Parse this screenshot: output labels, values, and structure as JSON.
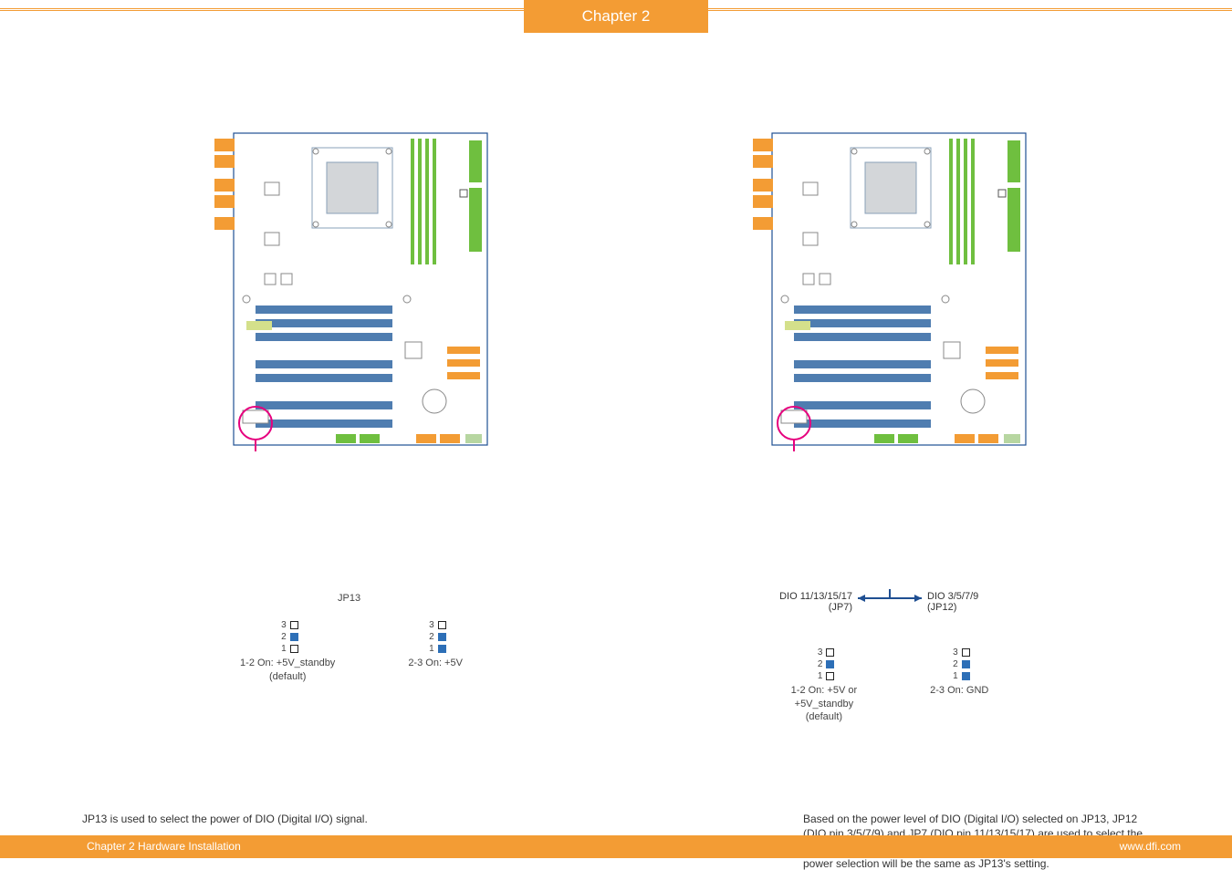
{
  "header": {
    "chapter": "Chapter 2"
  },
  "footer": {
    "left": "Chapter 2 Hardware Installation",
    "right": "www.dfi.com"
  },
  "left_panel": {
    "jp_label": "JP13",
    "jumper_a": {
      "pins": [
        "3",
        "2",
        "1"
      ],
      "filled": [
        false,
        true,
        false
      ],
      "caption_line1": "1-2 On: +5V_standby",
      "caption_line2": "(default)"
    },
    "jumper_b": {
      "pins": [
        "3",
        "2",
        "1"
      ],
      "filled": [
        false,
        true,
        true
      ],
      "caption_line1": "2-3 On: +5V",
      "caption_line2": ""
    },
    "description": "JP13 is used to select the power of DIO (Digital I/O) signal."
  },
  "right_panel": {
    "callout_left_line1": "DIO 11/13/15/17",
    "callout_left_line2": "(JP7)",
    "callout_right_line1": "DIO 3/5/7/9",
    "callout_right_line2": "(JP12)",
    "jumper_a": {
      "pins": [
        "3",
        "2",
        "1"
      ],
      "filled": [
        false,
        true,
        false
      ],
      "caption_line1": "1-2 On: +5V or",
      "caption_line2": "+5V_standby",
      "caption_line3": "(default)"
    },
    "jumper_b": {
      "pins": [
        "3",
        "2",
        "1"
      ],
      "filled": [
        false,
        true,
        true
      ],
      "caption_line1": "2-3 On: GND",
      "caption_line2": "",
      "caption_line3": ""
    },
    "description": "Based on the power level of DIO (Digital I/O) selected on JP13, JP12 (DIO pin 3/5/7/9) and JP7 (DIO pin 11/13/15/17) are used to select the state of DIO output: pull high or pull low. When selecting pull high, the power selection will be the same as JP13's setting."
  }
}
